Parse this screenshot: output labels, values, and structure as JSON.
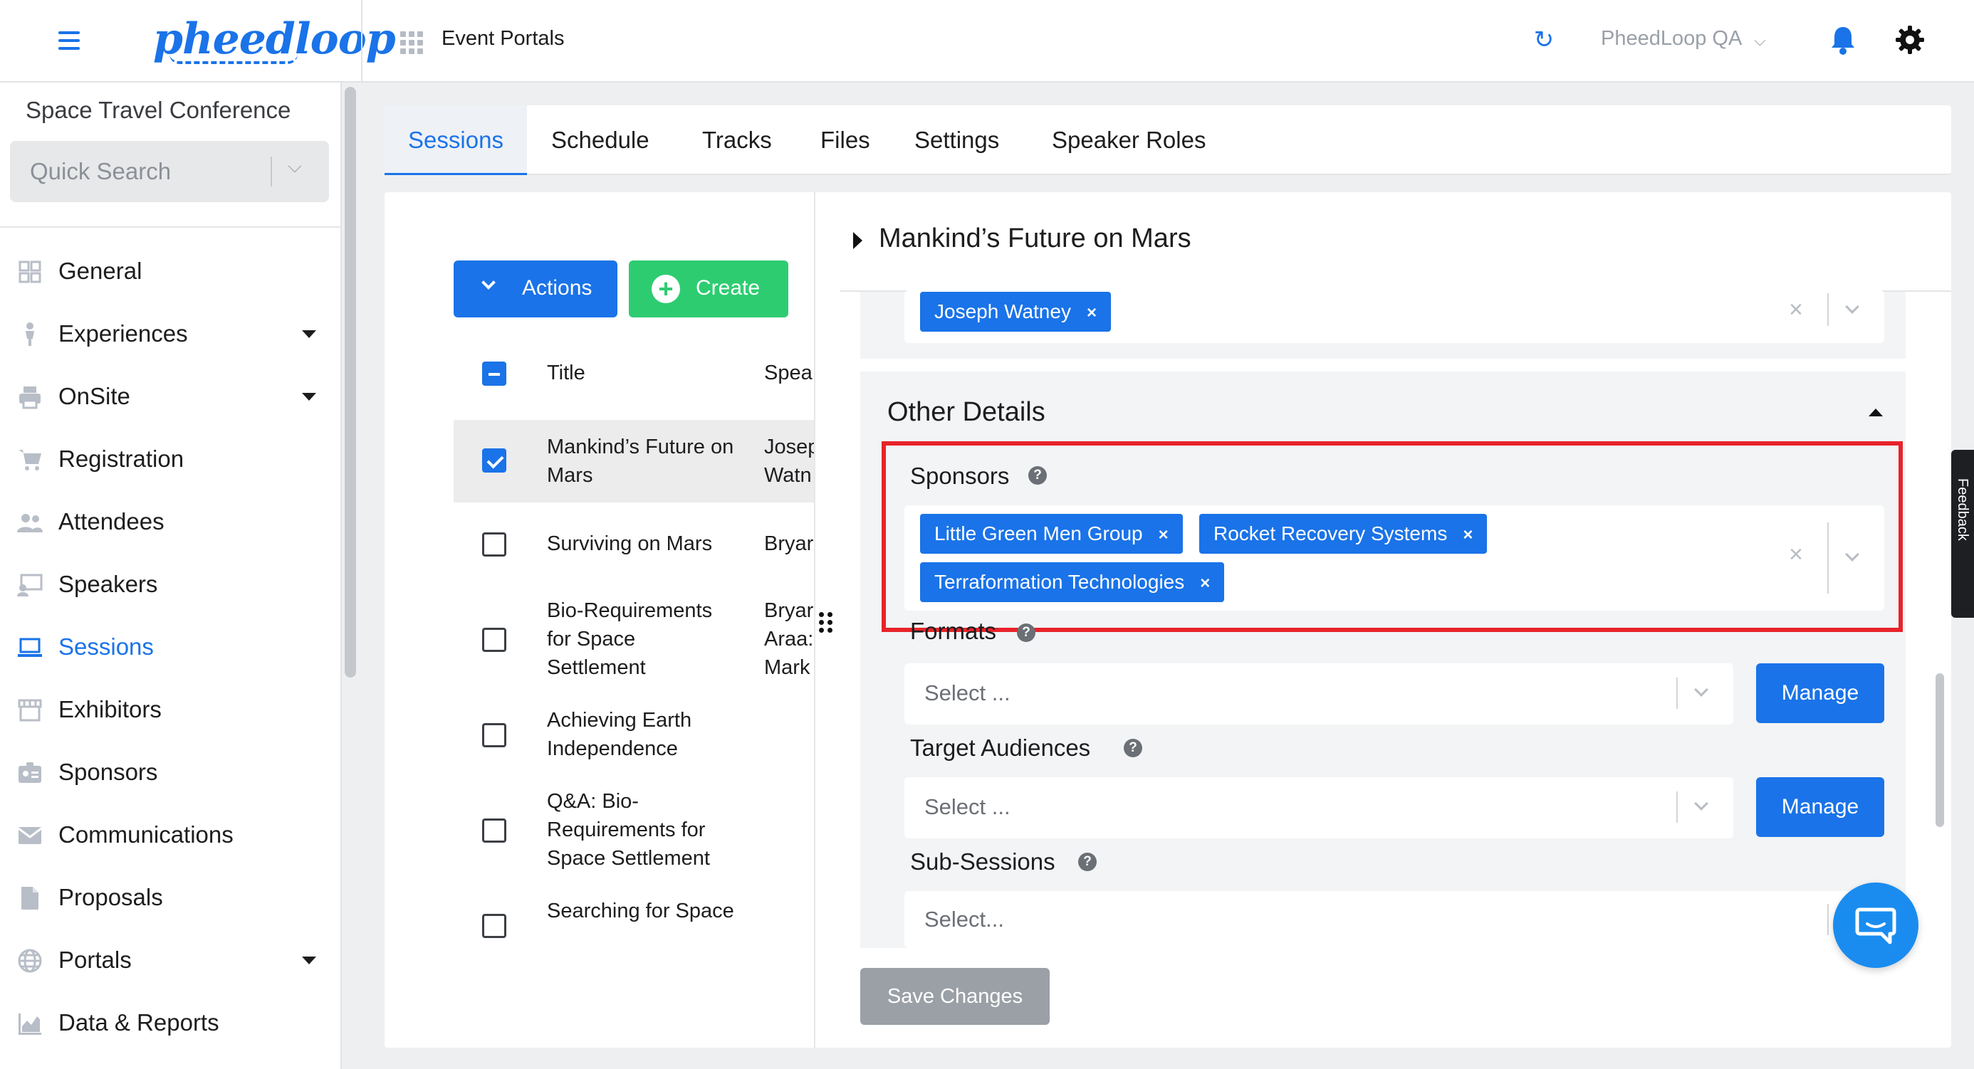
{
  "topbar": {
    "logo_text": "pheedloop",
    "portal_title": "Event Portals",
    "org_name": "PheedLoop QA",
    "icons": [
      "hamburger-menu-icon",
      "apps-grid-icon",
      "refresh-icon",
      "chevron-down-icon",
      "bell-icon",
      "gear-icon"
    ]
  },
  "sidebar": {
    "event_name": "Space Travel Conference",
    "quick_search_placeholder": "Quick Search",
    "items": [
      {
        "label": "General",
        "icon": "dashboard-icon",
        "has_caret": false
      },
      {
        "label": "Experiences",
        "icon": "person-icon",
        "has_caret": true
      },
      {
        "label": "OnSite",
        "icon": "printer-icon",
        "has_caret": true
      },
      {
        "label": "Registration",
        "icon": "cart-icon",
        "has_caret": false
      },
      {
        "label": "Attendees",
        "icon": "people-icon",
        "has_caret": false
      },
      {
        "label": "Speakers",
        "icon": "presenter-icon",
        "has_caret": false
      },
      {
        "label": "Sessions",
        "icon": "laptop-icon",
        "has_caret": false,
        "active": true
      },
      {
        "label": "Exhibitors",
        "icon": "storefront-icon",
        "has_caret": false
      },
      {
        "label": "Sponsors",
        "icon": "badge-icon",
        "has_caret": false
      },
      {
        "label": "Communications",
        "icon": "mail-icon",
        "has_caret": false
      },
      {
        "label": "Proposals",
        "icon": "document-icon",
        "has_caret": false
      },
      {
        "label": "Portals",
        "icon": "globe-icon",
        "has_caret": true
      },
      {
        "label": "Data & Reports",
        "icon": "chart-icon",
        "has_caret": false
      }
    ]
  },
  "tabs": [
    {
      "label": "Sessions",
      "active": true
    },
    {
      "label": "Schedule"
    },
    {
      "label": "Tracks"
    },
    {
      "label": "Files"
    },
    {
      "label": "Settings"
    },
    {
      "label": "Speaker Roles"
    }
  ],
  "list": {
    "actions_label": "Actions",
    "create_label": "Create",
    "columns": [
      "Title",
      "Spea"
    ],
    "rows": [
      {
        "title": "Mankind’s Future on Mars",
        "speaker": "Josep Watn",
        "checked": true
      },
      {
        "title": "Surviving on Mars",
        "speaker": "Bryar",
        "checked": false
      },
      {
        "title": "Bio-Requirements for Space Settlement",
        "speaker": "Bryar Araa: Mark",
        "checked": false
      },
      {
        "title": "Achieving Earth Independence",
        "speaker": "",
        "checked": false
      },
      {
        "title": "Q&A: Bio-Requirements for Space Settlement",
        "speaker": "",
        "checked": false
      },
      {
        "title": "Searching for Space",
        "speaker": "",
        "checked": false
      }
    ]
  },
  "detail": {
    "session_title": "Mankind’s Future on Mars",
    "speaker_tags": [
      "Joseph Watney"
    ],
    "section_title": "Other Details",
    "sponsors_label": "Sponsors",
    "sponsor_tags": [
      "Little Green Men Group",
      "Rocket Recovery Systems",
      "Terraformation Technologies"
    ],
    "formats_label": "Formats",
    "formats_placeholder": "Select ...",
    "manage_label": "Manage",
    "target_audiences_label": "Target Audiences",
    "target_audiences_placeholder": "Select ...",
    "sub_sessions_label": "Sub-Sessions",
    "sub_sessions_placeholder": "Select...",
    "save_label": "Save Changes",
    "help_glyph": "?",
    "tag_remove_glyph": "×"
  },
  "feedback_label": "Feedback",
  "colors": {
    "primary": "#1a73e8",
    "create_green": "#2ecc71",
    "highlight_red": "#e8232a",
    "save_disabled": "#9aa0a6"
  }
}
